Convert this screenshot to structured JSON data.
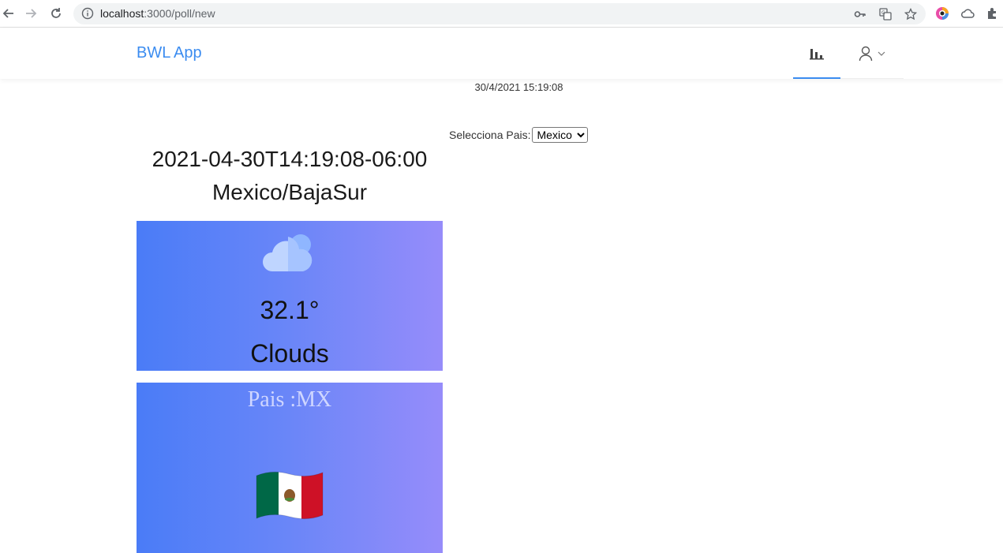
{
  "browser": {
    "url_host": "localhost",
    "url_rest": ":3000/poll/new"
  },
  "header": {
    "brand": "BWL App",
    "menu": [
      {
        "icon": "bar-chart-icon",
        "active": true
      },
      {
        "icon": "user-icon",
        "dropdown": true
      }
    ]
  },
  "clock": "30/4/2021 15:19:08",
  "country_selector": {
    "label": "Selecciona Pais:",
    "selected": "Mexico"
  },
  "timezone": {
    "datetime": "2021-04-30T14:19:08-06:00",
    "zone": "Mexico/BajaSur"
  },
  "weather": {
    "icon": "cloud-icon",
    "temperature": "32.1°",
    "condition": "Clouds"
  },
  "country": {
    "code_label": "Pais :MX",
    "flag_icon": "mexico-flag-icon"
  },
  "colors": {
    "accent": "#3b8cf0",
    "card_gradient_start": "#4a7cf7",
    "card_gradient_end": "#968cfa"
  }
}
